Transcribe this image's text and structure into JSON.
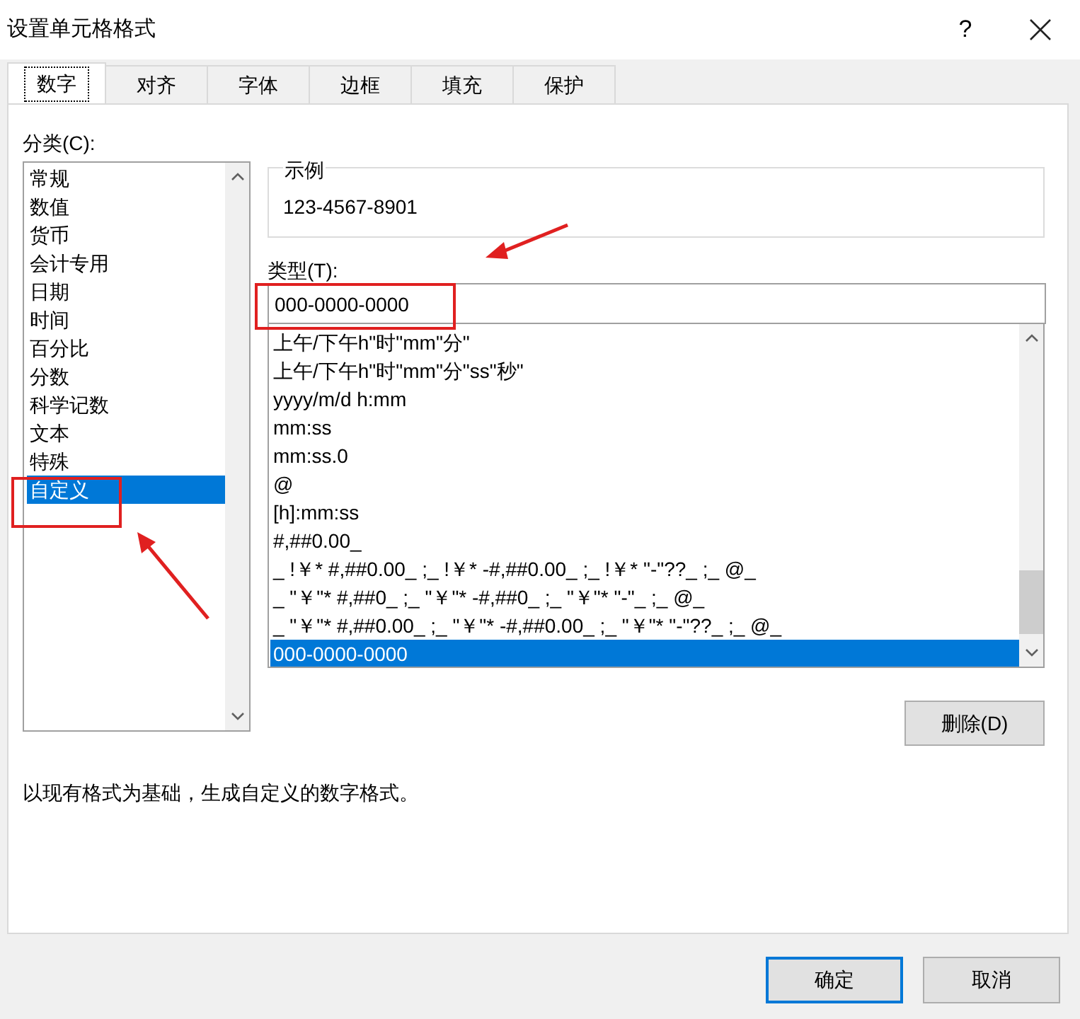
{
  "window": {
    "title": "设置单元格格式",
    "help": "?"
  },
  "tabs": [
    {
      "label": "数字",
      "selected": true
    },
    {
      "label": "对齐",
      "selected": false
    },
    {
      "label": "字体",
      "selected": false
    },
    {
      "label": "边框",
      "selected": false
    },
    {
      "label": "填充",
      "selected": false
    },
    {
      "label": "保护",
      "selected": false
    }
  ],
  "category": {
    "label": "分类(C):",
    "items": [
      {
        "label": "常规",
        "selected": false
      },
      {
        "label": "数值",
        "selected": false
      },
      {
        "label": "货币",
        "selected": false
      },
      {
        "label": "会计专用",
        "selected": false
      },
      {
        "label": "日期",
        "selected": false
      },
      {
        "label": "时间",
        "selected": false
      },
      {
        "label": "百分比",
        "selected": false
      },
      {
        "label": "分数",
        "selected": false
      },
      {
        "label": "科学记数",
        "selected": false
      },
      {
        "label": "文本",
        "selected": false
      },
      {
        "label": "特殊",
        "selected": false
      },
      {
        "label": "自定义",
        "selected": true
      }
    ]
  },
  "sample": {
    "label": "示例",
    "value": "123-4567-8901"
  },
  "type": {
    "label": "类型(T):",
    "value": "000-0000-0000",
    "items": [
      {
        "label": "上午/下午h\"时\"mm\"分\"",
        "selected": false
      },
      {
        "label": "上午/下午h\"时\"mm\"分\"ss\"秒\"",
        "selected": false
      },
      {
        "label": "yyyy/m/d h:mm",
        "selected": false
      },
      {
        "label": "mm:ss",
        "selected": false
      },
      {
        "label": "mm:ss.0",
        "selected": false
      },
      {
        "label": "@",
        "selected": false
      },
      {
        "label": "[h]:mm:ss",
        "selected": false
      },
      {
        "label": "#,##0.00_",
        "selected": false
      },
      {
        "label": "_ !￥* #,##0.00_ ;_ !￥* -#,##0.00_ ;_ !￥* \"-\"??_ ;_ @_",
        "selected": false
      },
      {
        "label": "_ \"￥\"* #,##0_ ;_ \"￥\"* -#,##0_ ;_ \"￥\"* \"-\"_ ;_ @_",
        "selected": false
      },
      {
        "label": "_ \"￥\"* #,##0.00_ ;_ \"￥\"* -#,##0.00_ ;_ \"￥\"* \"-\"??_ ;_ @_",
        "selected": false
      },
      {
        "label": "000-0000-0000",
        "selected": true
      }
    ]
  },
  "delete_button": "删除(D)",
  "description": "以现有格式为基础，生成自定义的数字格式。",
  "buttons": [
    "确定",
    "取消"
  ]
}
